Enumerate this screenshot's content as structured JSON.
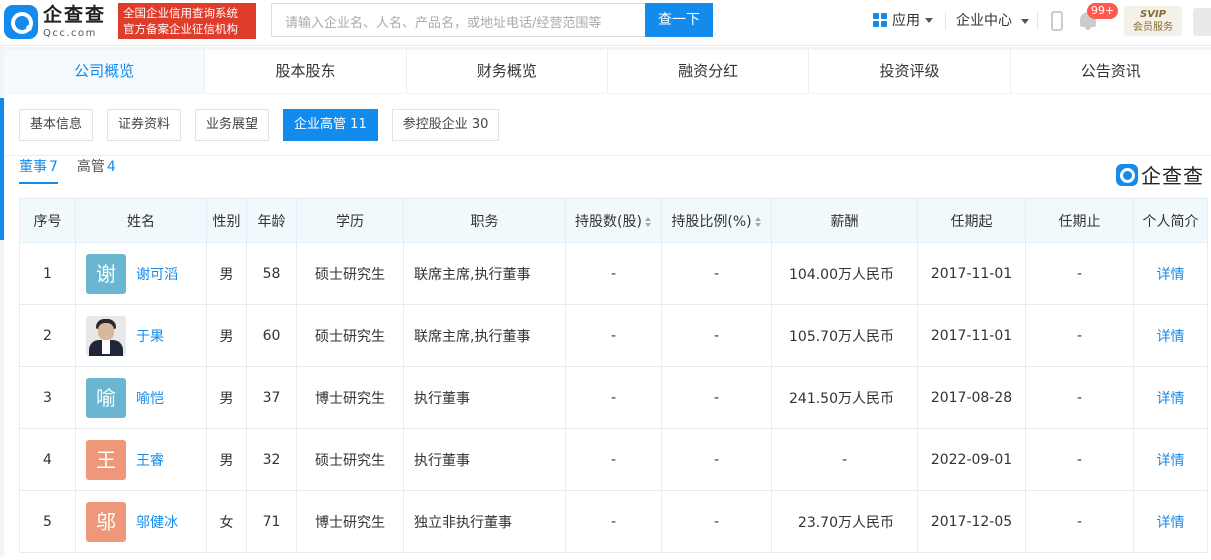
{
  "header": {
    "logo_cn": "企查查",
    "logo_en": "Qcc.com",
    "slogan_line1": "全国企业信用查询系统",
    "slogan_line2": "官方备案企业征信机构",
    "search_placeholder": "请输入企业名、人名、产品名，或地址电话/经营范围等",
    "search_button": "查一下",
    "apps_label": "应用",
    "enterprise_center": "企业中心",
    "notification_badge": "99+",
    "svip_label": "SVIP",
    "svip_sub": "会员服务"
  },
  "main_tabs": [
    {
      "label": "公司概览",
      "active": true
    },
    {
      "label": "股本股东",
      "active": false
    },
    {
      "label": "财务概览",
      "active": false
    },
    {
      "label": "融资分红",
      "active": false
    },
    {
      "label": "投资评级",
      "active": false
    },
    {
      "label": "公告资讯",
      "active": false
    }
  ],
  "sub_tabs": [
    {
      "label": "基本信息"
    },
    {
      "label": "证券资料"
    },
    {
      "label": "业务展望"
    },
    {
      "label": "企业高管 11"
    },
    {
      "label": "参控股企业 30"
    }
  ],
  "role_tabs": [
    {
      "label": "董事",
      "count": "7"
    },
    {
      "label": "高管",
      "count": "4"
    }
  ],
  "brand_watermark": "企查查",
  "table": {
    "headers": [
      "序号",
      "姓名",
      "性别",
      "年龄",
      "学历",
      "职务",
      "持股数(股)",
      "持股比例(%)",
      "薪酬",
      "任期起",
      "任期止",
      "个人简介"
    ],
    "rows": [
      {
        "no": "1",
        "avatar": "谢",
        "avatar_color": "#6ab5cf",
        "name": "谢可滔",
        "gender": "男",
        "age": "58",
        "edu": "硕士研究生",
        "title": "联席主席,执行董事",
        "shares": "-",
        "ratio": "-",
        "salary": "104.00万人民币",
        "start": "2017-11-01",
        "end": "-",
        "bio": "详情"
      },
      {
        "no": "2",
        "avatar": "",
        "avatar_color": "#e8e8e8",
        "name": "于果",
        "gender": "男",
        "age": "60",
        "edu": "硕士研究生",
        "title": "联席主席,执行董事",
        "shares": "-",
        "ratio": "-",
        "salary": "105.70万人民币",
        "start": "2017-11-01",
        "end": "-",
        "bio": "详情"
      },
      {
        "no": "3",
        "avatar": "喻",
        "avatar_color": "#6ab5cf",
        "name": "喻恺",
        "gender": "男",
        "age": "37",
        "edu": "博士研究生",
        "title": "执行董事",
        "shares": "-",
        "ratio": "-",
        "salary": "241.50万人民币",
        "start": "2017-08-28",
        "end": "-",
        "bio": "详情"
      },
      {
        "no": "4",
        "avatar": "王",
        "avatar_color": "#ee9779",
        "name": "王睿",
        "gender": "男",
        "age": "32",
        "edu": "硕士研究生",
        "title": "执行董事",
        "shares": "-",
        "ratio": "-",
        "salary": "-",
        "start": "2022-09-01",
        "end": "-",
        "bio": "详情"
      },
      {
        "no": "5",
        "avatar": "邬",
        "avatar_color": "#ee9779",
        "name": "邬健冰",
        "gender": "女",
        "age": "71",
        "edu": "博士研究生",
        "title": "独立非执行董事",
        "shares": "-",
        "ratio": "-",
        "salary": "23.70万人民币",
        "start": "2017-12-05",
        "end": "-",
        "bio": "详情"
      }
    ]
  }
}
